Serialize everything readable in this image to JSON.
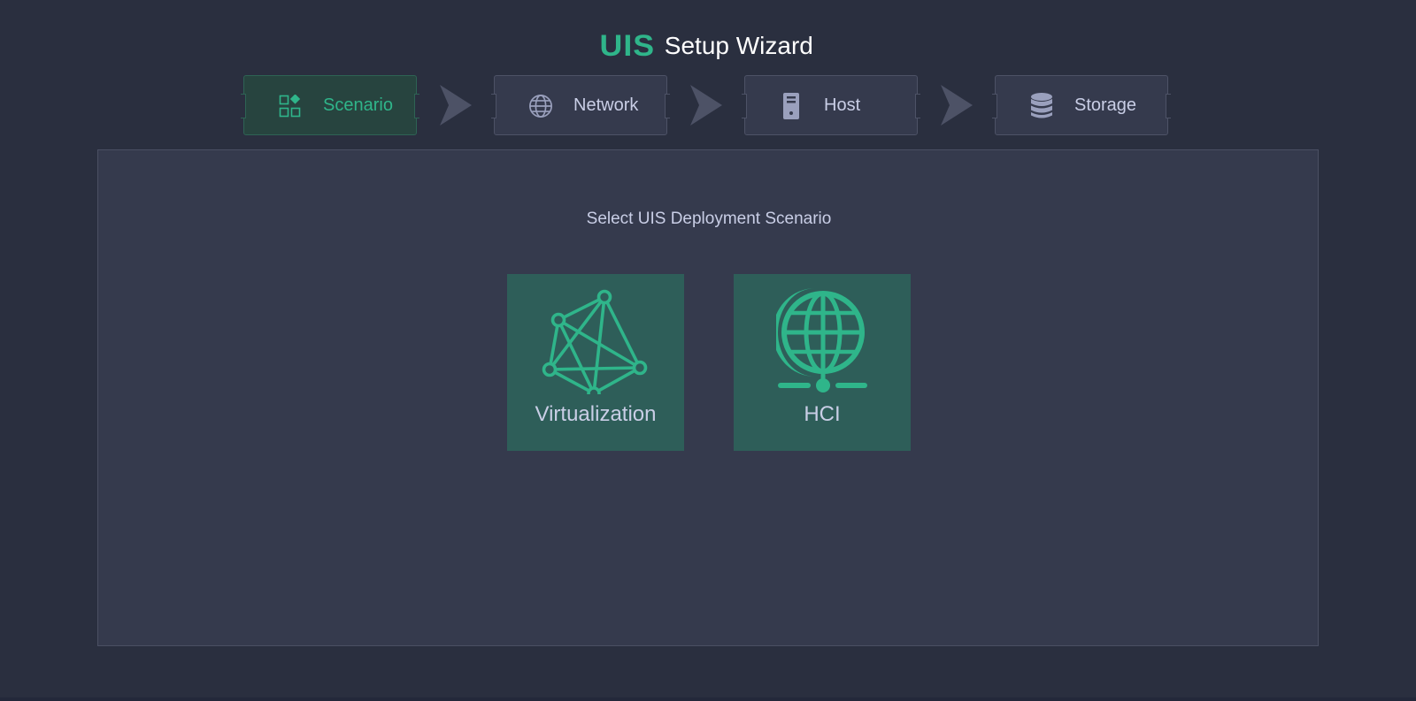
{
  "header": {
    "logo_text": "UIS",
    "title": "Setup Wizard"
  },
  "steps": [
    {
      "label": "Scenario",
      "icon": "apps-icon",
      "active": true
    },
    {
      "label": "Network",
      "icon": "globe-icon",
      "active": false
    },
    {
      "label": "Host",
      "icon": "server-icon",
      "active": false
    },
    {
      "label": "Storage",
      "icon": "database-icon",
      "active": false
    }
  ],
  "main": {
    "title": "Select UIS Deployment Scenario",
    "cards": [
      {
        "label": "Virtualization",
        "icon": "network-mesh-icon"
      },
      {
        "label": "HCI",
        "icon": "globe-network-icon"
      }
    ]
  },
  "colors": {
    "accent": "#2fb58a",
    "background": "#2a2f3f",
    "panel": "#353a4d",
    "card": "#2e5e59",
    "text": "#c9cee6"
  }
}
